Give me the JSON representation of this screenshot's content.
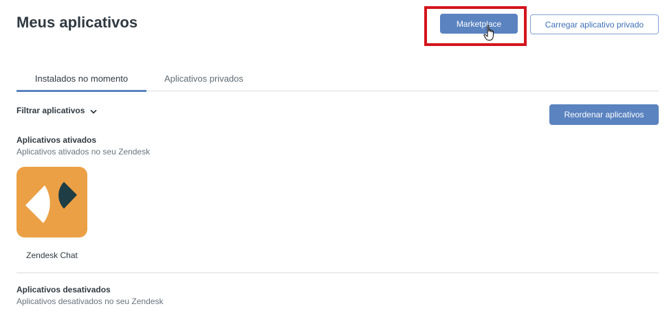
{
  "header": {
    "title": "Meus aplicativos",
    "marketplace_label": "Marketplace",
    "upload_private_label": "Carregar aplicativo privado"
  },
  "tabs": [
    {
      "label": "Instalados no momento",
      "active": true
    },
    {
      "label": "Aplicativos privados",
      "active": false
    }
  ],
  "filter": {
    "label": "Filtrar aplicativos",
    "icon": "chevron-down-icon"
  },
  "reorder_label": "Reordenar aplicativos",
  "enabled_section": {
    "title": "Aplicativos ativados",
    "subtitle": "Aplicativos ativados no seu Zendesk",
    "apps": [
      {
        "name": "Zendesk Chat",
        "icon": "zendesk-chat-logo",
        "tile_color": "#eba045"
      }
    ]
  },
  "disabled_section": {
    "title": "Aplicativos desativados",
    "subtitle": "Aplicativos desativados no seu Zendesk"
  },
  "colors": {
    "primary": "#5a83c0",
    "highlight_box": "#d4141c",
    "text": "#2f3941",
    "muted_text": "#68737d"
  }
}
